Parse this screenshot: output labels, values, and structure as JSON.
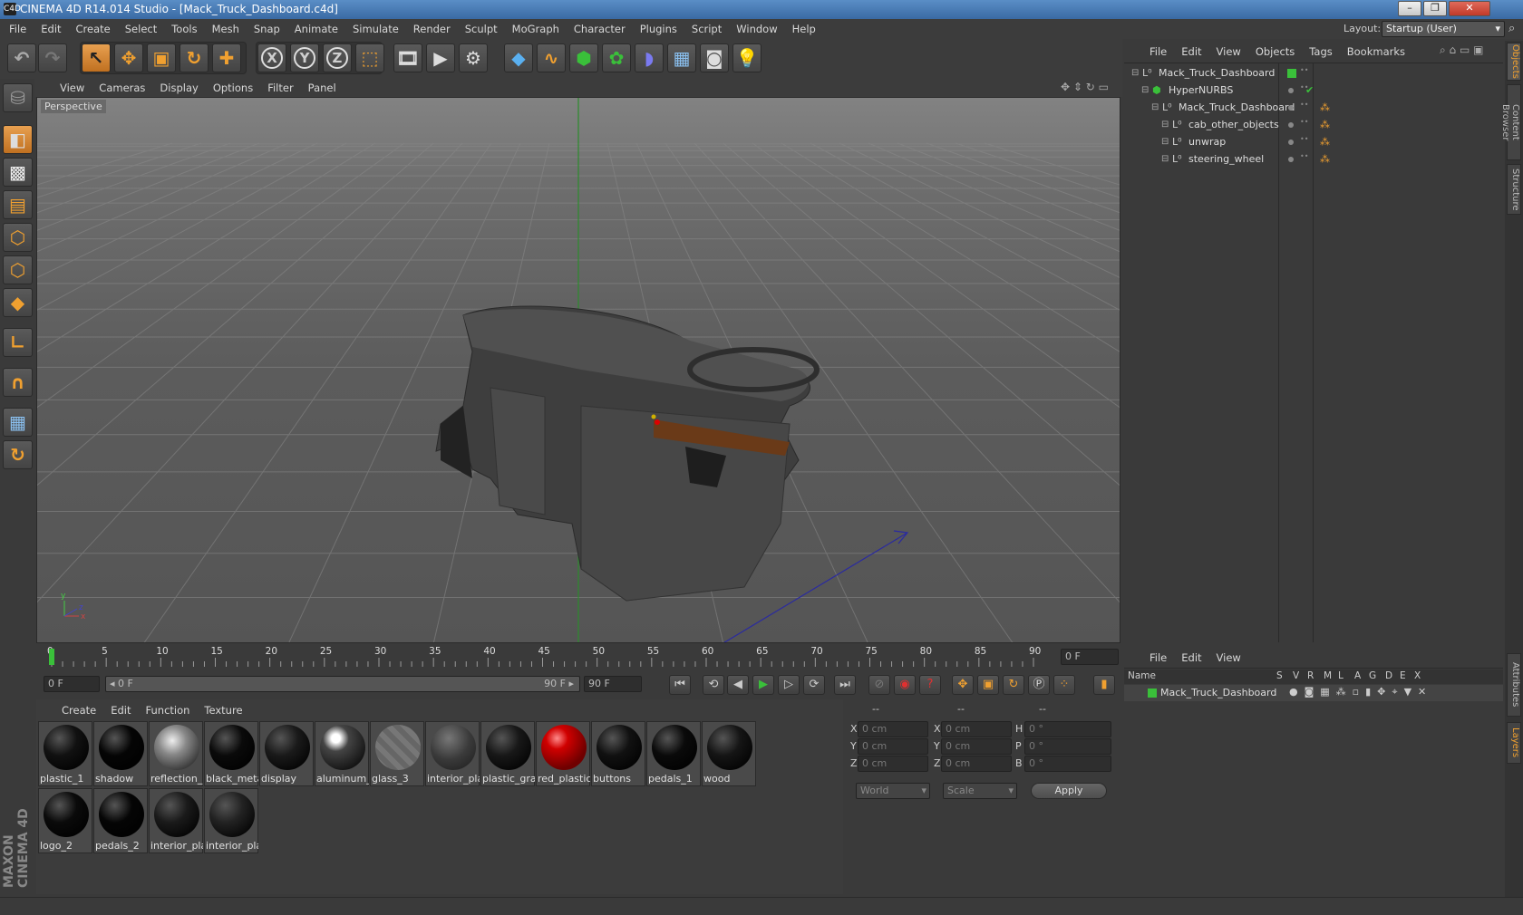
{
  "window": {
    "title": "CINEMA 4D R14.014 Studio - [Mack_Truck_Dashboard.c4d]",
    "app_icon": "C4D"
  },
  "winbuttons": {
    "minimize": "–",
    "restore": "❐",
    "close": "✕"
  },
  "menubar": {
    "items": [
      "File",
      "Edit",
      "Create",
      "Select",
      "Tools",
      "Mesh",
      "Snap",
      "Animate",
      "Simulate",
      "Render",
      "Sculpt",
      "MoGraph",
      "Character",
      "Plugins",
      "Script",
      "Window",
      "Help"
    ],
    "layout_label": "Layout:",
    "layout_value": "Startup (User)"
  },
  "toolbar": {
    "icons": [
      "undo-icon",
      "redo-icon",
      "live-selection-icon",
      "move-icon",
      "scale-icon",
      "rotate-icon",
      "add-icon",
      "x-axis-icon",
      "y-axis-icon",
      "z-axis-icon",
      "coordinate-system-icon",
      "render-view-icon",
      "render-picture-viewer-icon",
      "render-settings-icon",
      "cube-icon",
      "spline-icon",
      "nurbs-icon",
      "array-icon",
      "deformer-icon",
      "floor-icon",
      "camera-icon",
      "light-icon"
    ],
    "axis_labels": [
      "X",
      "Y",
      "Z"
    ]
  },
  "viewport": {
    "menu": [
      "View",
      "Cameras",
      "Display",
      "Options",
      "Filter",
      "Panel"
    ],
    "label": "Perspective"
  },
  "timeline": {
    "ticks": [
      "0",
      "5",
      "10",
      "15",
      "20",
      "25",
      "30",
      "35",
      "40",
      "45",
      "50",
      "55",
      "60",
      "65",
      "70",
      "75",
      "80",
      "85",
      "90"
    ],
    "current_frame": "0 F"
  },
  "transport": {
    "start_field": "0 F",
    "slider_start": "◂ 0 F",
    "slider_end": "90 F ▸",
    "end_field": "90 F"
  },
  "materials": {
    "menu": [
      "Create",
      "Edit",
      "Function",
      "Texture"
    ],
    "items": [
      {
        "label": "plastic_1",
        "color": "#111"
      },
      {
        "label": "shadow",
        "color": "#050505"
      },
      {
        "label": "reflection_",
        "color": "#777"
      },
      {
        "label": "black_meta",
        "color": "#0a0a0a"
      },
      {
        "label": "display",
        "color": "#1a1a1a"
      },
      {
        "label": "aluminum_",
        "color": "#333"
      },
      {
        "label": "glass_3",
        "color": "transparent"
      },
      {
        "label": "interior_pla",
        "color": "#3a3a3a"
      },
      {
        "label": "plastic_gra",
        "color": "#181818"
      },
      {
        "label": "red_plastic",
        "color": "#c00000"
      },
      {
        "label": "buttons",
        "color": "#111"
      },
      {
        "label": "pedals_1",
        "color": "#0a0a0a"
      },
      {
        "label": "wood",
        "color": "#151515"
      },
      {
        "label": "logo_2",
        "color": "#0a0a0a"
      },
      {
        "label": "pedals_2",
        "color": "#050505"
      },
      {
        "label": "interior_pla",
        "color": "#1a1a1a"
      },
      {
        "label": "interior_pla",
        "color": "#222"
      }
    ]
  },
  "coordinates": {
    "headers": [
      "--",
      "--",
      "--"
    ],
    "rows": [
      {
        "a": "X",
        "av": "0 cm",
        "b": "X",
        "bv": "0 cm",
        "c": "H",
        "cv": "0 °"
      },
      {
        "a": "Y",
        "av": "0 cm",
        "b": "Y",
        "bv": "0 cm",
        "c": "P",
        "cv": "0 °"
      },
      {
        "a": "Z",
        "av": "0 cm",
        "b": "Z",
        "bv": "0 cm",
        "c": "B",
        "cv": "0 °"
      }
    ],
    "space_select": "World",
    "mode_select": "Scale",
    "apply_label": "Apply"
  },
  "objects": {
    "menu": [
      "File",
      "Edit",
      "View",
      "Objects",
      "Tags",
      "Bookmarks"
    ],
    "rows": [
      {
        "name": "Mack_Truck_Dashboard",
        "indent": 0
      },
      {
        "name": "HyperNURBS",
        "indent": 1
      },
      {
        "name": "Mack_Truck_Dashboard",
        "indent": 2
      },
      {
        "name": "cab_other_objects",
        "indent": 3
      },
      {
        "name": "unwrap",
        "indent": 3
      },
      {
        "name": "steering_wheel",
        "indent": 3
      }
    ]
  },
  "layers": {
    "menu": [
      "File",
      "Edit",
      "View"
    ],
    "headers": [
      "Name",
      "S",
      "V",
      "R",
      "M",
      "L",
      "A",
      "G",
      "D",
      "E",
      "X"
    ],
    "row_name": "Mack_Truck_Dashboard"
  },
  "right_tabs": [
    "Objects",
    "Content Browser",
    "Structure",
    "Attributes",
    "Layers"
  ],
  "branding": "MAXON CINEMA 4D",
  "colors": {
    "accent": "#f0a030",
    "green": "#3ac03a",
    "title_blue": "#4a7cb8"
  }
}
